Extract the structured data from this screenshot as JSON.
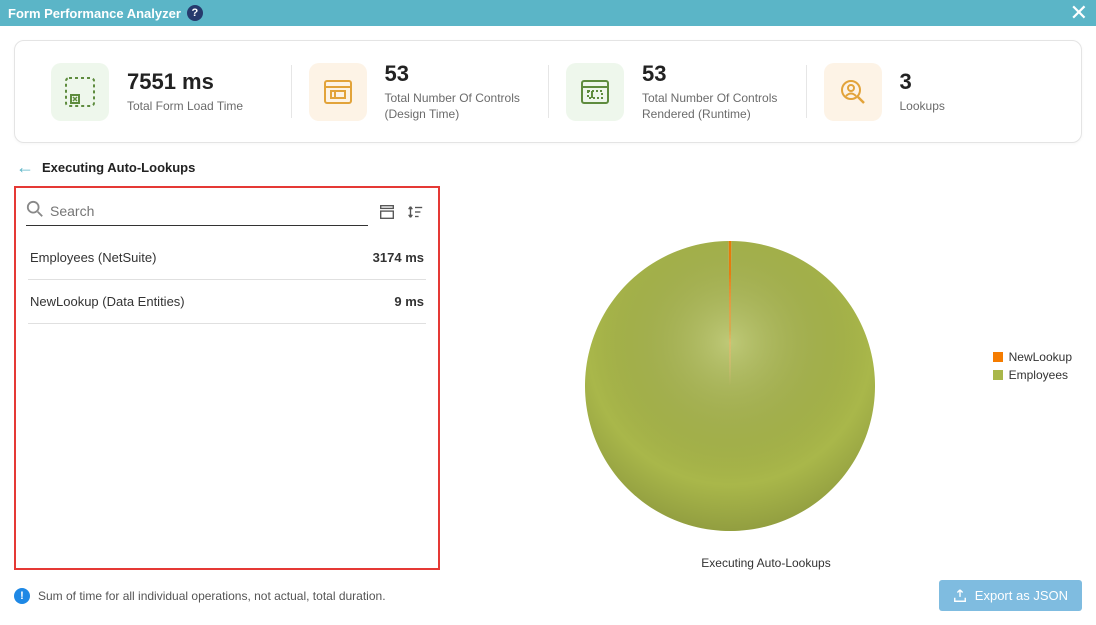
{
  "header": {
    "title": "Form Performance Analyzer"
  },
  "stats": [
    {
      "value": "7551 ms",
      "label": "Total Form Load Time"
    },
    {
      "value": "53",
      "label": "Total Number Of Controls (Design Time)"
    },
    {
      "value": "53",
      "label": "Total Number Of Controls Rendered (Runtime)"
    },
    {
      "value": "3",
      "label": "Lookups"
    }
  ],
  "section": {
    "title": "Executing Auto-Lookups"
  },
  "search": {
    "placeholder": "Search"
  },
  "list": [
    {
      "name": "Employees (NetSuite)",
      "value": "3174 ms"
    },
    {
      "name": "NewLookup (Data Entities)",
      "value": "9 ms"
    }
  ],
  "chart": {
    "caption": "Executing Auto-Lookups"
  },
  "chart_data": {
    "type": "pie",
    "title": "Executing Auto-Lookups",
    "series": [
      {
        "name": "NewLookup",
        "value": 9,
        "color": "#f57c00"
      },
      {
        "name": "Employees",
        "value": 3174,
        "color": "#a9b74a"
      }
    ],
    "legend_position": "right"
  },
  "footer": {
    "note": "Sum of time for all individual operations, not actual, total duration.",
    "export_label": "Export as JSON"
  }
}
